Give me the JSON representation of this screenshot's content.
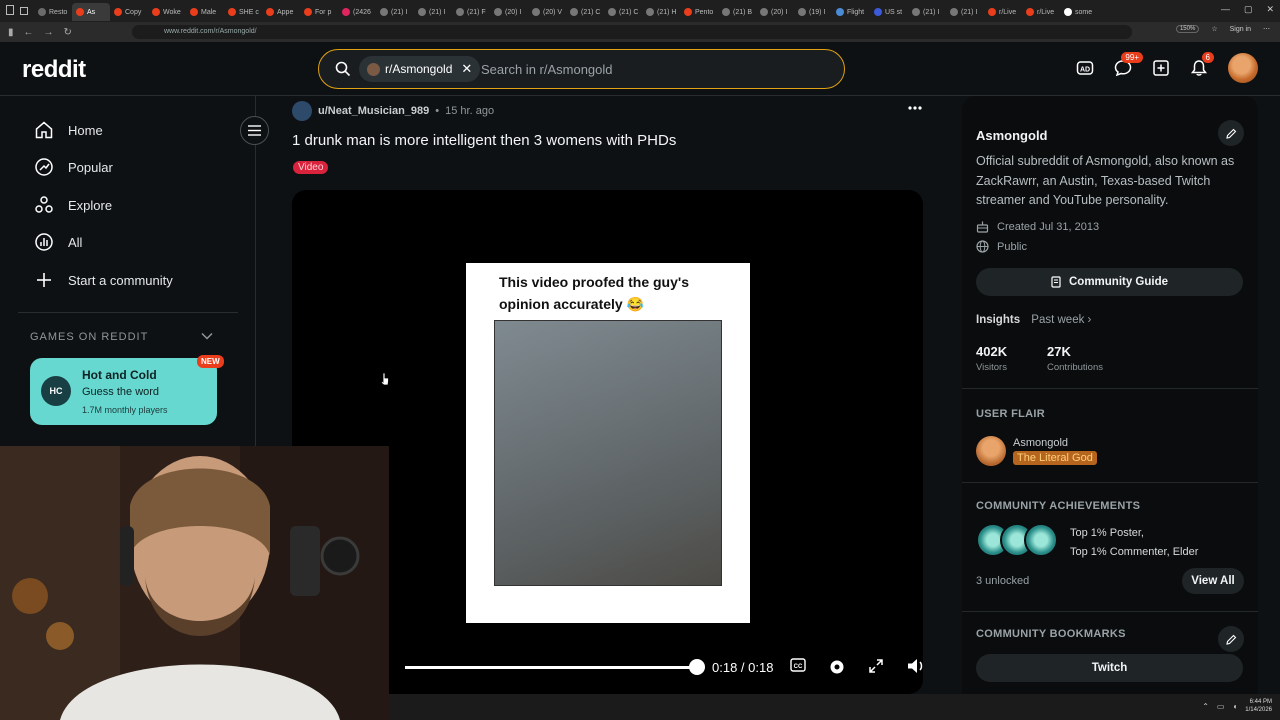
{
  "browser": {
    "tabs": [
      "Resto",
      "As",
      "Copy",
      "Woke",
      "Male",
      "SHE c",
      "Appe",
      "For p",
      "(2426",
      "(21) I",
      "(21) I",
      "(21) F",
      "(20) I",
      "(20) V",
      "(21) C",
      "(21) C",
      "(21) H",
      "Pento",
      "(21) B",
      "(20) I",
      "(19) I",
      "Flight",
      "US st",
      "(21) I",
      "(21) I",
      "r/Live",
      "r/Live",
      "some"
    ],
    "active_tab_index": 1,
    "url": "www.reddit.com/r/Asmongold/",
    "zoom": "150%",
    "signin_label": "Sign in"
  },
  "header": {
    "logo": "reddit",
    "search_chip": "r/Asmongold",
    "search_placeholder": "Search in r/Asmongold",
    "chat_badge": "99+",
    "notif_badge": "6"
  },
  "leftnav": {
    "items": [
      "Home",
      "Popular",
      "Explore",
      "All",
      "Start a community"
    ],
    "games_heading": "GAMES ON REDDIT",
    "game": {
      "icon_text": "HC",
      "title": "Hot and Cold",
      "subtitle": "Guess the word",
      "players": "1.7M monthly players",
      "badge": "NEW"
    }
  },
  "post": {
    "author": "u/Neat_Musician_989",
    "time": "15 hr. ago",
    "title": "1 drunk man is more intelligent then 3 womens with PHDs",
    "flair": "Video",
    "video_caption": "This video proofed the guy's opinion accurately 😂",
    "timecode": "0:18 / 0:18",
    "progress": 1.0
  },
  "sidebar": {
    "name": "Asmongold",
    "description": "Official subreddit of Asmongold, also known as ZackRawrr, an Austin, Texas-based Twitch streamer and YouTube personality.",
    "created": "Created Jul 31, 2013",
    "visibility": "Public",
    "guide_label": "Community Guide",
    "insights_label": "Insights",
    "insights_period": "Past week ›",
    "visitors_num": "402K",
    "visitors_label": "Visitors",
    "contrib_num": "27K",
    "contrib_label": "Contributions",
    "user_flair_heading": "USER FLAIR",
    "flair_user": "Asmongold",
    "flair_tag": "The Literal God",
    "achievements_heading": "COMMUNITY ACHIEVEMENTS",
    "achievement_line1": "Top 1% Poster,",
    "achievement_line2": "Top 1% Commenter, Elder",
    "unlocked": "3 unlocked",
    "view_all": "View All",
    "bookmarks_heading": "COMMUNITY BOOKMARKS",
    "bookmark": "Twitch"
  },
  "taskbar": {
    "time": "6:44 PM",
    "date": "1/14/2026"
  },
  "colors": {
    "accent_search": "#e0a112",
    "badge_red": "#ea3d1c",
    "game_card": "#67d8cf",
    "flair_orange": "#b5651d"
  }
}
